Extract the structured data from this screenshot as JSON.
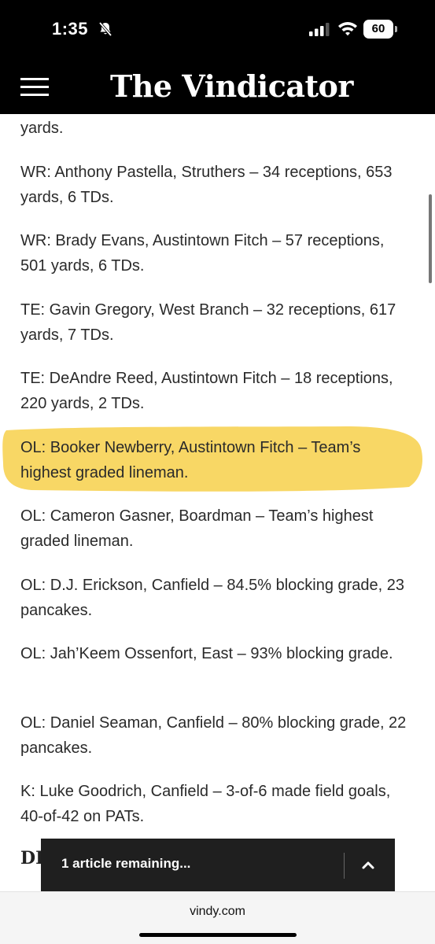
{
  "status_bar": {
    "time": "1:35",
    "battery": "60"
  },
  "masthead": {
    "logo": "The Vindicator"
  },
  "article": {
    "paragraphs": [
      "yards.",
      "WR: Anthony Pastella, Struthers – 34 receptions, 653 yards, 6 TDs.",
      "WR: Brady Evans, Austintown Fitch – 57 receptions, 501 yards, 6 TDs.",
      "TE: Gavin Gregory, West Branch – 32 receptions, 617 yards, 7 TDs.",
      "TE: DeAndre Reed, Austintown Fitch – 18 receptions, 220 yards, 2 TDs.",
      "OL: Booker Newberry, Austintown Fitch – Team’s highest graded lineman.",
      "OL: Cameron Gasner, Boardman – Team’s highest graded lineman.",
      "OL: D.J. Erickson, Canfield – 84.5% blocking grade, 23 pancakes.",
      "OL: Jah’Keem Ossenfort, East – 93% blocking grade.",
      "OL: Daniel Seaman, Canfield – 80% blocking grade, 22 pancakes.",
      "K: Luke Goodrich, Canfield – 3-of-6 made field goals, 40-of-42 on PATs."
    ],
    "section_heading_partial": "DE",
    "highlight_color": "#f7d04a"
  },
  "toast": {
    "text": "1 article remaining..."
  },
  "browser": {
    "domain": "vindy.com"
  }
}
